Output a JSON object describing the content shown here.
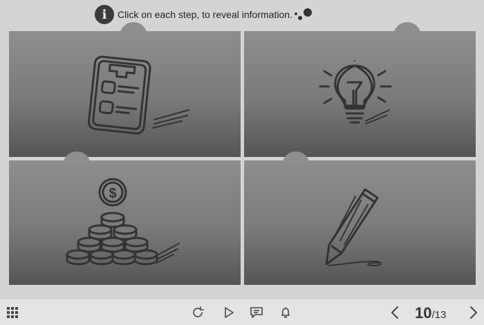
{
  "header": {
    "info_icon_glyph": "i",
    "instruction": "Click on each step, to reveal information."
  },
  "steps": [
    {
      "icon": "checklist-icon"
    },
    {
      "icon": "lightbulb-icon"
    },
    {
      "icon": "coins-icon"
    },
    {
      "icon": "pencil-icon"
    }
  ],
  "footer": {
    "menu_icon": "grid-menu-icon",
    "controls": [
      "replay-icon",
      "play-icon",
      "comment-icon",
      "bell-icon"
    ],
    "current_page": "10",
    "total_pages": "/13"
  },
  "colors": {
    "background": "#d4d4d4",
    "panel_top": "#8e8e8e",
    "panel_bottom": "#555555",
    "footer": "#e4e4e4",
    "icon_stroke": "#333333"
  }
}
